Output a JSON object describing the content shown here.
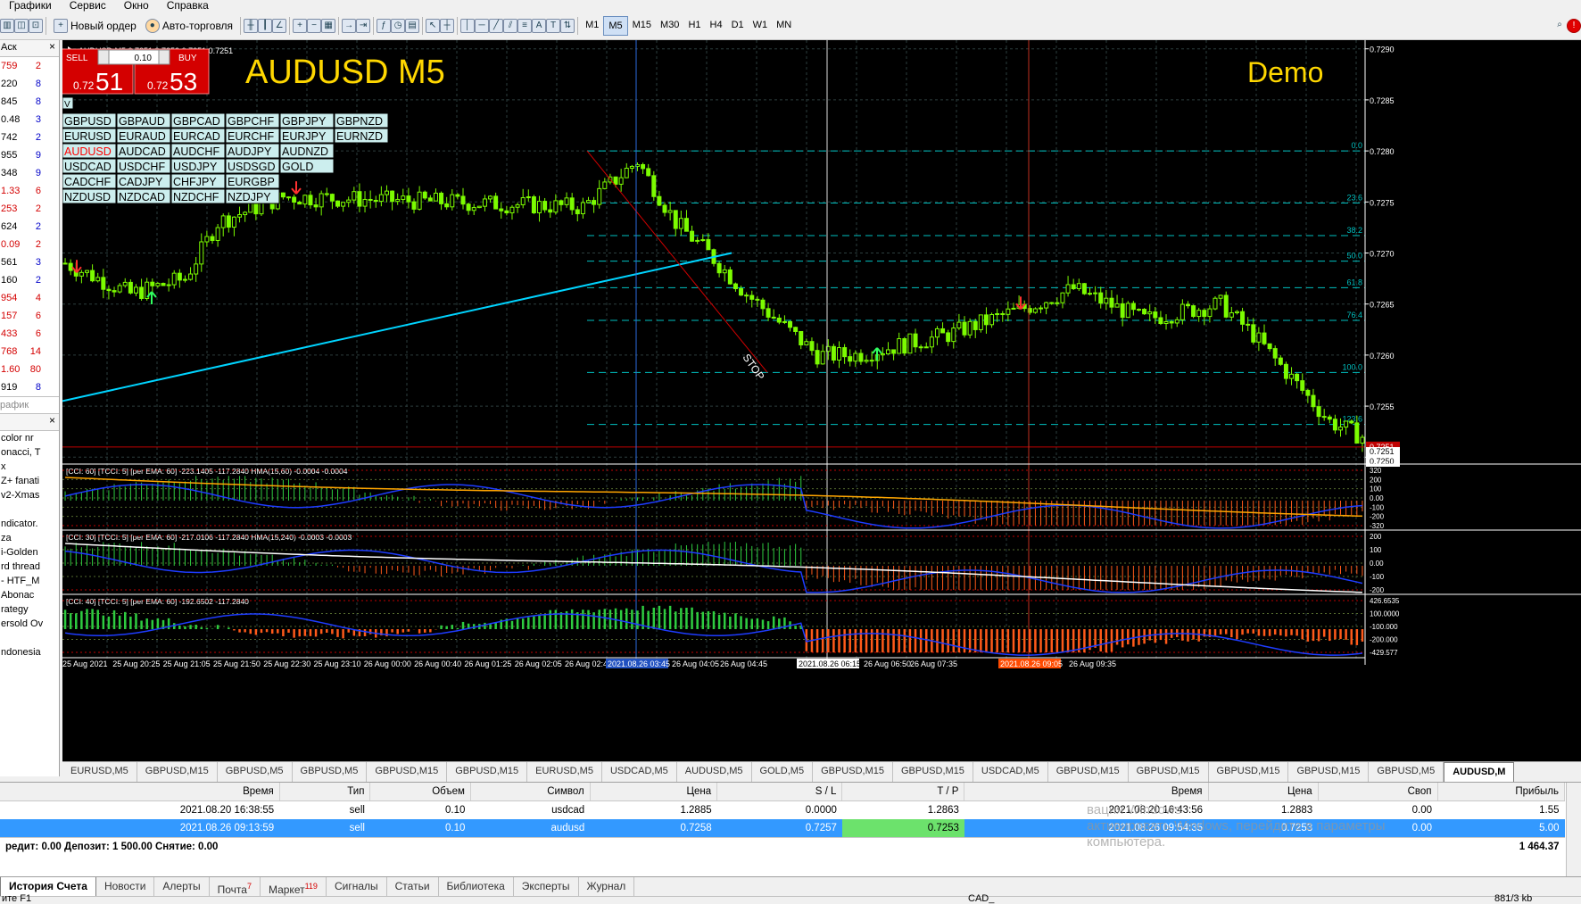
{
  "menu": [
    "Графики",
    "Сервис",
    "Окно",
    "Справка"
  ],
  "toolbar": {
    "new_order": "Новый ордер",
    "autotrading": "Авто-торговля",
    "timeframes": [
      "M1",
      "M5",
      "M15",
      "M30",
      "H1",
      "H4",
      "D1",
      "W1",
      "MN"
    ],
    "selected_timeframe": "M5"
  },
  "market_watch": {
    "header": "Аск",
    "rows": [
      {
        "ask": "759",
        "spread": "2"
      },
      {
        "ask": "220",
        "spread": "8"
      },
      {
        "ask": "845",
        "spread": "8"
      },
      {
        "ask": "0.48",
        "spread": "3"
      },
      {
        "ask": "742",
        "spread": "2"
      },
      {
        "ask": "955",
        "spread": "9"
      },
      {
        "ask": "348",
        "spread": "9"
      },
      {
        "ask": "1.33",
        "spread": "6"
      },
      {
        "ask": "253",
        "spread": "2"
      },
      {
        "ask": "624",
        "spread": "2"
      },
      {
        "ask": "0.09",
        "spread": "2"
      },
      {
        "ask": "561",
        "spread": "3"
      },
      {
        "ask": "160",
        "spread": "2"
      },
      {
        "ask": "954",
        "spread": "4"
      },
      {
        "ask": "157",
        "spread": "6"
      },
      {
        "ask": "433",
        "spread": "6"
      },
      {
        "ask": "768",
        "spread": "14"
      },
      {
        "ask": "1.60",
        "spread": "80"
      },
      {
        "ask": "919",
        "spread": "8"
      }
    ],
    "red_rows": [
      0,
      7,
      8,
      10,
      13,
      14,
      15,
      16,
      17
    ],
    "tab": "рафик"
  },
  "navigator": {
    "items": [
      "color nr",
      "onacci, T",
      "x",
      "Z+ fanati",
      "v2-Xmas",
      "",
      "ndicator.",
      "za",
      "i-Golden",
      "rd thread",
      "- HTF_M",
      "Abonac",
      "rategy",
      "ersold Ov",
      "",
      "ndonesia"
    ]
  },
  "chart": {
    "header": "AUDUSD,M5  0.7251 0.7252 0.7251 0.7251",
    "big_title": "AUDUSD M5",
    "mode": "Demo",
    "one_click": {
      "sell": "SELL",
      "buy": "BUY",
      "lot": "0.10",
      "sell_price_small": "0.72",
      "sell_price_big": "51",
      "buy_price_small": "0.72",
      "buy_price_big": "53"
    },
    "symbol_toggle": "V",
    "symbols": [
      [
        "GBPUSD",
        "GBPAUD",
        "GBPCAD",
        "GBPCHF",
        "GBPJPY",
        "GBPNZD"
      ],
      [
        "EURUSD",
        "EURAUD",
        "EURCAD",
        "EURCHF",
        "EURJPY",
        "EURNZD"
      ],
      [
        "AUDUSD",
        "AUDCAD",
        "AUDCHF",
        "AUDJPY",
        "AUDNZD"
      ],
      [
        "USDCAD",
        "USDCHF",
        "USDJPY",
        "USDSGD",
        "GOLD"
      ],
      [
        "CADCHF",
        "CADJPY",
        "CHFJPY",
        "EURGBP"
      ],
      [
        "NZDUSD",
        "NZDCAD",
        "NZDCHF",
        "NZDJPY"
      ]
    ],
    "active_symbol": "AUDUSD",
    "price_ticks": [
      "0.7290",
      "0.7285",
      "0.7280",
      "0.7275",
      "0.7270",
      "0.7265",
      "0.7260",
      "0.7255",
      "0.7250"
    ],
    "current_price": "0.7251",
    "bid_label": "0.7251",
    "ask_label": "0.7250",
    "fib_levels": [
      {
        "label": "0.0",
        "price": 0.728
      },
      {
        "label": "23.6",
        "price": 0.72749
      },
      {
        "label": "38.2",
        "price": 0.72717
      },
      {
        "label": "50.0",
        "price": 0.72692
      },
      {
        "label": "61.8",
        "price": 0.72666
      },
      {
        "label": "76.4",
        "price": 0.72634
      },
      {
        "label": "100.0",
        "price": 0.72583
      },
      {
        "label": "123.6",
        "price": 0.72532
      }
    ],
    "annotation": "STOP",
    "time_labels": [
      "25 Aug 2021",
      "25 Aug 20:25",
      "25 Aug 21:05",
      "25 Aug 21:50",
      "25 Aug 22:30",
      "25 Aug 23:10",
      "26 Aug 00:00",
      "26 Aug 00:40",
      "26 Aug 01:25",
      "26 Aug 02:05",
      "26 Aug 02:45",
      "26 Aug 04:05",
      "26 Aug 04:45",
      "26 Aug 06:50",
      "26 Aug 07:35",
      "26 Aug 09:35"
    ],
    "time_marks": [
      {
        "label": "2021.08.26 03:45",
        "color": "#2050c0"
      },
      {
        "label": "2021.08.26 06:15",
        "color": "#ffffff"
      },
      {
        "label": "2021.08.26 09:05",
        "color": "#ff4a00"
      }
    ],
    "indicator1": {
      "title": "[CCI: 60] [TCCI: 5] [per EMA: 60] -223.1405 -117.2840  HMA(15,60) -0.0004 -0.0004",
      "ticks": [
        "320",
        "200",
        "100",
        "0.00",
        "-100",
        "-200",
        "-320"
      ]
    },
    "indicator2": {
      "title": "[CCI: 30] [TCCI: 5] [per EMA: 60] -217.0106 -117.2840  HMA(15,240) -0.0003 -0.0003",
      "ticks": [
        "200",
        "100",
        "0.00",
        "-100",
        "-200"
      ]
    },
    "indicator3": {
      "title": "[CCI: 40] [TCCI: 5] [per EMA: 60] -192.6502 -117.2840",
      "ticks": [
        "426.6535",
        "100.0000",
        "-100.000",
        "-200.000",
        "-429.577"
      ]
    }
  },
  "chart_tabs": [
    "EURUSD,M5",
    "GBPUSD,M15",
    "GBPUSD,M5",
    "GBPUSD,M5",
    "GBPUSD,M15",
    "GBPUSD,M15",
    "EURUSD,M5",
    "USDCAD,M5",
    "AUDUSD,M5",
    "GOLD,M5",
    "GBPUSD,M15",
    "GBPUSD,M15",
    "USDCAD,M5",
    "GBPUSD,M15",
    "GBPUSD,M15",
    "GBPUSD,M15",
    "GBPUSD,M15",
    "GBPUSD,M5",
    "AUDUSD,M"
  ],
  "active_chart_tab": 18,
  "terminal": {
    "columns": [
      "Время",
      "Тип",
      "Объем",
      "Символ",
      "Цена",
      "S / L",
      "T / P",
      "Время",
      "Цена",
      "Своп",
      "Прибыль"
    ],
    "rows": [
      [
        "2021.08.20 16:38:55",
        "sell",
        "0.10",
        "usdcad",
        "1.2885",
        "0.0000",
        "1.2863",
        "2021.08.20 16:43:56",
        "1.2883",
        "0.00",
        "1.55"
      ],
      [
        "2021.08.26 09:13:59",
        "sell",
        "0.10",
        "audusd",
        "0.7258",
        "0.7257",
        "0.7253",
        "2021.08.26 09:54:35",
        "0.7253",
        "0.00",
        "5.00"
      ]
    ],
    "summary": "редит: 0.00  Депозит: 1 500.00  Снятие: 0.00",
    "total": "1 464.37",
    "watermark": [
      "вация Windows",
      "активировать Windows, перейдите в параметры",
      "компьютера."
    ]
  },
  "terminal_tabs": [
    {
      "label": "История Счета"
    },
    {
      "label": "Новости"
    },
    {
      "label": "Алерты"
    },
    {
      "label": "Почта",
      "badge": "7"
    },
    {
      "label": "Маркет",
      "badge": "119"
    },
    {
      "label": "Сигналы"
    },
    {
      "label": "Статьи"
    },
    {
      "label": "Библиотека"
    },
    {
      "label": "Эксперты"
    },
    {
      "label": "Журнал"
    }
  ],
  "status": {
    "help": "ите F1",
    "symbol": "CAD_",
    "traffic": "881/3 kb"
  },
  "colors": {
    "candle": "#7cfc00",
    "fib": "#00c0c0",
    "trendline": "#00d4ff",
    "grid": "#2f4f4f",
    "current_price_line": "#c00000",
    "selected_row": "#3399ff",
    "tp_cell": "#6ce26c"
  }
}
